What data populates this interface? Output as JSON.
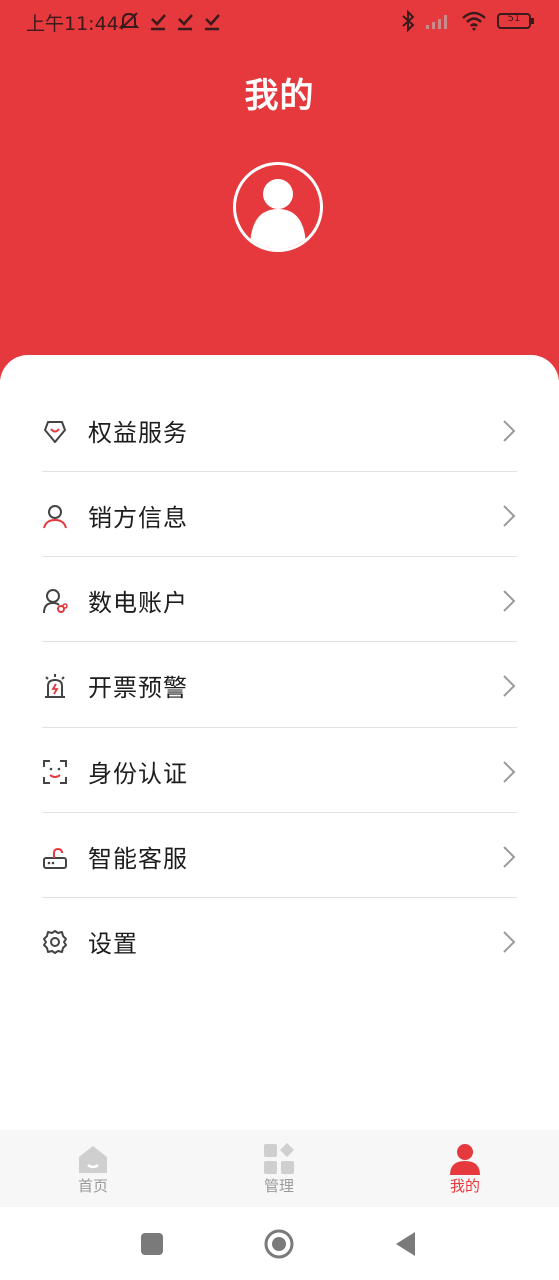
{
  "status_bar": {
    "time": "上午11:44",
    "battery": "51"
  },
  "header": {
    "title": "我的"
  },
  "menu": [
    {
      "label": "权益服务",
      "icon": "shield-heart-icon"
    },
    {
      "label": "销方信息",
      "icon": "person-icon"
    },
    {
      "label": "数电账户",
      "icon": "account-link-icon"
    },
    {
      "label": "开票预警",
      "icon": "alarm-icon"
    },
    {
      "label": "身份认证",
      "icon": "face-scan-icon"
    },
    {
      "label": "智能客服",
      "icon": "router-icon"
    },
    {
      "label": "设置",
      "icon": "gear-icon"
    }
  ],
  "tabbar": {
    "home": "首页",
    "manage": "管理",
    "mine": "我的"
  },
  "colors": {
    "brand": "#e5393e",
    "inactive_tab": "#9a9a9a",
    "divider": "#e2e2e2"
  }
}
